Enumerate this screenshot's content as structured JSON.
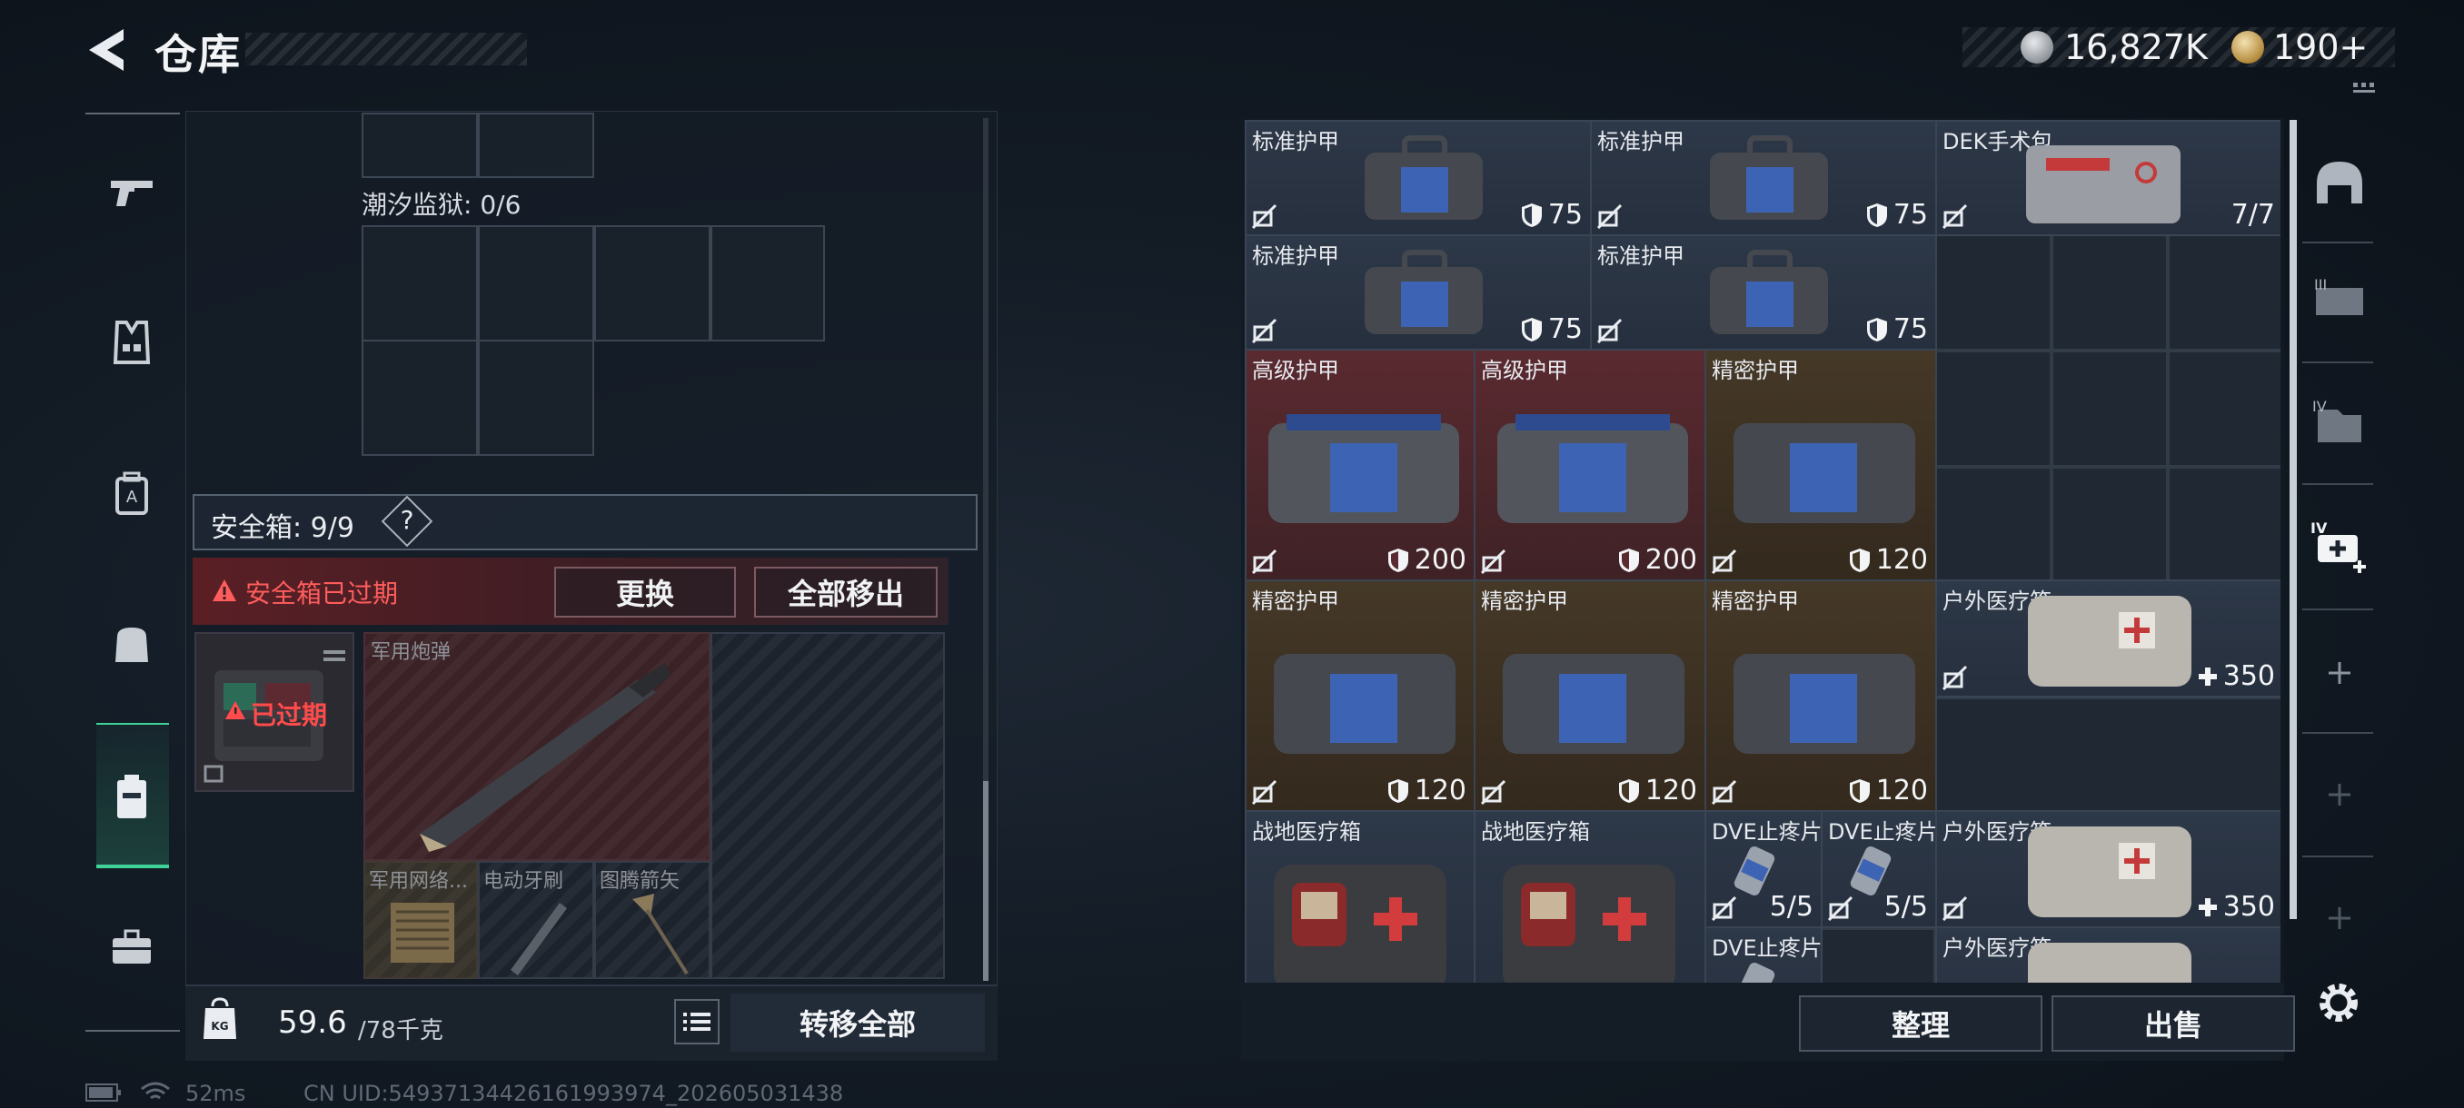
{
  "header": {
    "title": "仓库",
    "currency_silver": "16,827K",
    "currency_gold": "190",
    "currency_gold_plus": "+"
  },
  "left_nav": {
    "items": [
      "weapon",
      "vest",
      "backpack",
      "bag",
      "safe-box",
      "toolbox"
    ],
    "active": "safe-box"
  },
  "storage": {
    "prison_label": "潮汐监狱: 0/6",
    "safe_label": "安全箱: 9/9",
    "help": "?",
    "expired_warning": "安全箱已过期",
    "replace_button": "更换",
    "move_all_button": "全部移出",
    "case_status": "已过期",
    "items": {
      "shell": "军用炮弹",
      "network": "军用网络...",
      "toothbrush": "电动牙刷",
      "arrow": "图腾箭矢"
    }
  },
  "weight": {
    "current": "59.6",
    "max": "/78千克",
    "transfer_all": "转移全部"
  },
  "grid": {
    "tiles": [
      {
        "name": "标准护甲",
        "value": "75"
      },
      {
        "name": "标准护甲",
        "value": "75"
      },
      {
        "name": "DEK手术包",
        "value": "7/7"
      },
      {
        "name": "标准护甲",
        "value": "75"
      },
      {
        "name": "标准护甲",
        "value": "75"
      },
      {
        "name": "高级护甲",
        "value": "200"
      },
      {
        "name": "高级护甲",
        "value": "200"
      },
      {
        "name": "精密护甲",
        "value": "120"
      },
      {
        "name": "精密护甲",
        "value": "120"
      },
      {
        "name": "精密护甲",
        "value": "120"
      },
      {
        "name": "精密护甲",
        "value": "120"
      },
      {
        "name": "户外医疗箱",
        "value": "350"
      },
      {
        "name": "战地医疗箱",
        "value": ""
      },
      {
        "name": "战地医疗箱",
        "value": ""
      },
      {
        "name": "DVE止疼片",
        "value": "5/5"
      },
      {
        "name": "DVE止疼片",
        "value": "5/5"
      },
      {
        "name": "户外医疗箱",
        "value": "350"
      },
      {
        "name": "DVE止疼片",
        "value": ""
      },
      {
        "name": "户外医疗箱",
        "value": ""
      }
    ],
    "sort_button": "整理",
    "sell_button": "出售"
  },
  "right_nav": {
    "labels": [
      "III",
      "IV",
      "IV"
    ]
  },
  "footer": {
    "ping": "52ms",
    "uid": "CN UID:5493713442616199397​4_202605031438"
  },
  "colors": {
    "accent_green": "#3fd39a",
    "warning_red": "#ff5d5d",
    "tile_red": "#5a2a30",
    "tile_brown": "#453827"
  }
}
